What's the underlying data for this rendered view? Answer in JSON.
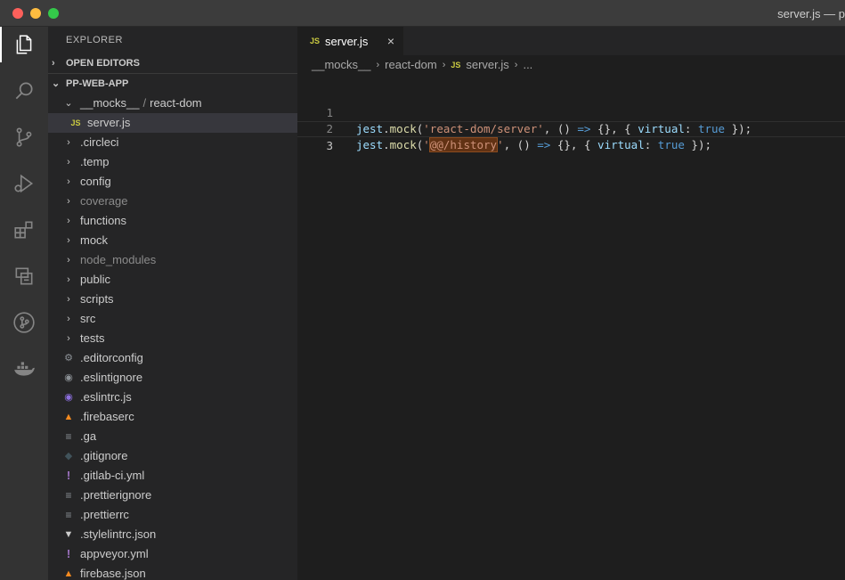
{
  "window": {
    "title": "server.js — p"
  },
  "colors": {
    "activity_bar": "#333333",
    "sidebar": "#252526",
    "editor": "#1e1e1e",
    "js_badge": "#cbcb41"
  },
  "activity_bar": {
    "items": [
      {
        "icon": "files-icon",
        "active": true
      },
      {
        "icon": "search-icon"
      },
      {
        "icon": "source-control-icon"
      },
      {
        "icon": "run-debug-icon"
      },
      {
        "icon": "extensions-icon"
      },
      {
        "icon": "remote-explorer-icon"
      },
      {
        "icon": "git-graph-icon"
      },
      {
        "icon": "docker-icon"
      }
    ]
  },
  "sidebar": {
    "title": "EXPLORER",
    "open_editors": "OPEN EDITORS",
    "project": "PP-WEB-APP",
    "tree": {
      "mocks_folder": "__mocks__",
      "mocks_sep": "/",
      "mocks_sub": "react-dom",
      "js_badge": "JS",
      "server_file": "server.js",
      "folders": [
        ".circleci",
        ".temp",
        "config",
        "coverage",
        "functions",
        "mock",
        "node_modules",
        "public",
        "scripts",
        "src",
        "tests"
      ],
      "files": [
        ".editorconfig",
        ".eslintignore",
        ".eslintrc.js",
        ".firebaserc",
        ".ga",
        ".gitignore",
        ".gitlab-ci.yml",
        ".prettierignore",
        ".prettierrc",
        ".stylelintrc.json",
        "appveyor.yml",
        "firebase.json"
      ]
    }
  },
  "editor": {
    "tab": {
      "badge": "JS",
      "label": "server.js",
      "close": "×"
    },
    "breadcrumb": {
      "part1": "__mocks__",
      "part2": "react-dom",
      "badge": "JS",
      "part3": "server.js",
      "part4": "..."
    },
    "lines": [
      {
        "num": "1",
        "str": "'react-dom/server'"
      },
      {
        "num": "2",
        "str_open": "'",
        "str_hl": "@@/history",
        "str_close": "'"
      },
      {
        "num": "3"
      }
    ],
    "tokens": {
      "obj": "jest",
      "dot": ".",
      "fn": "mock",
      "open": "(",
      "comma": ", ",
      "arrow_params": "()",
      "arrow": "=>",
      "empty_obj": "{}",
      "brace_open": "{ ",
      "prop": "virtual",
      "colon": ": ",
      "bool": "true",
      "brace_close": " }",
      "close": ");"
    }
  }
}
